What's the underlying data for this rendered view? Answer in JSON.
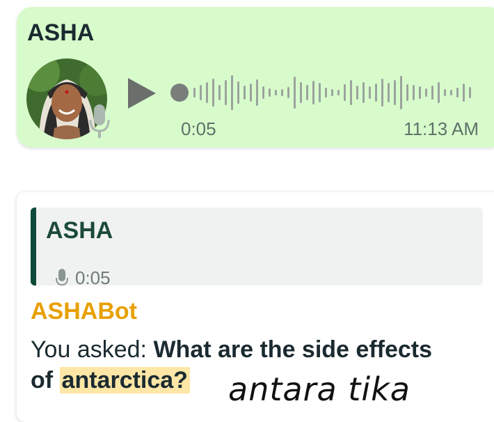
{
  "voice_message": {
    "sender": "ASHA",
    "duration": "0:05",
    "time": "11:13 AM",
    "avatar_icon": "person-avatar",
    "mic_icon": "microphone-icon",
    "play_icon": "play-icon",
    "accent_color": "#d8fbcc"
  },
  "bot_reply": {
    "quoted": {
      "sender": "ASHA",
      "duration": "0:05",
      "mic_icon": "microphone-icon"
    },
    "bot_name": "ASHABot",
    "prefix": "You asked: ",
    "question_main": "What are the side effects",
    "question_of": "of",
    "question_term": "antarctica?",
    "name_color": "#e8a000",
    "highlight_color": "#fde6a6"
  },
  "annotation": "antara tika"
}
